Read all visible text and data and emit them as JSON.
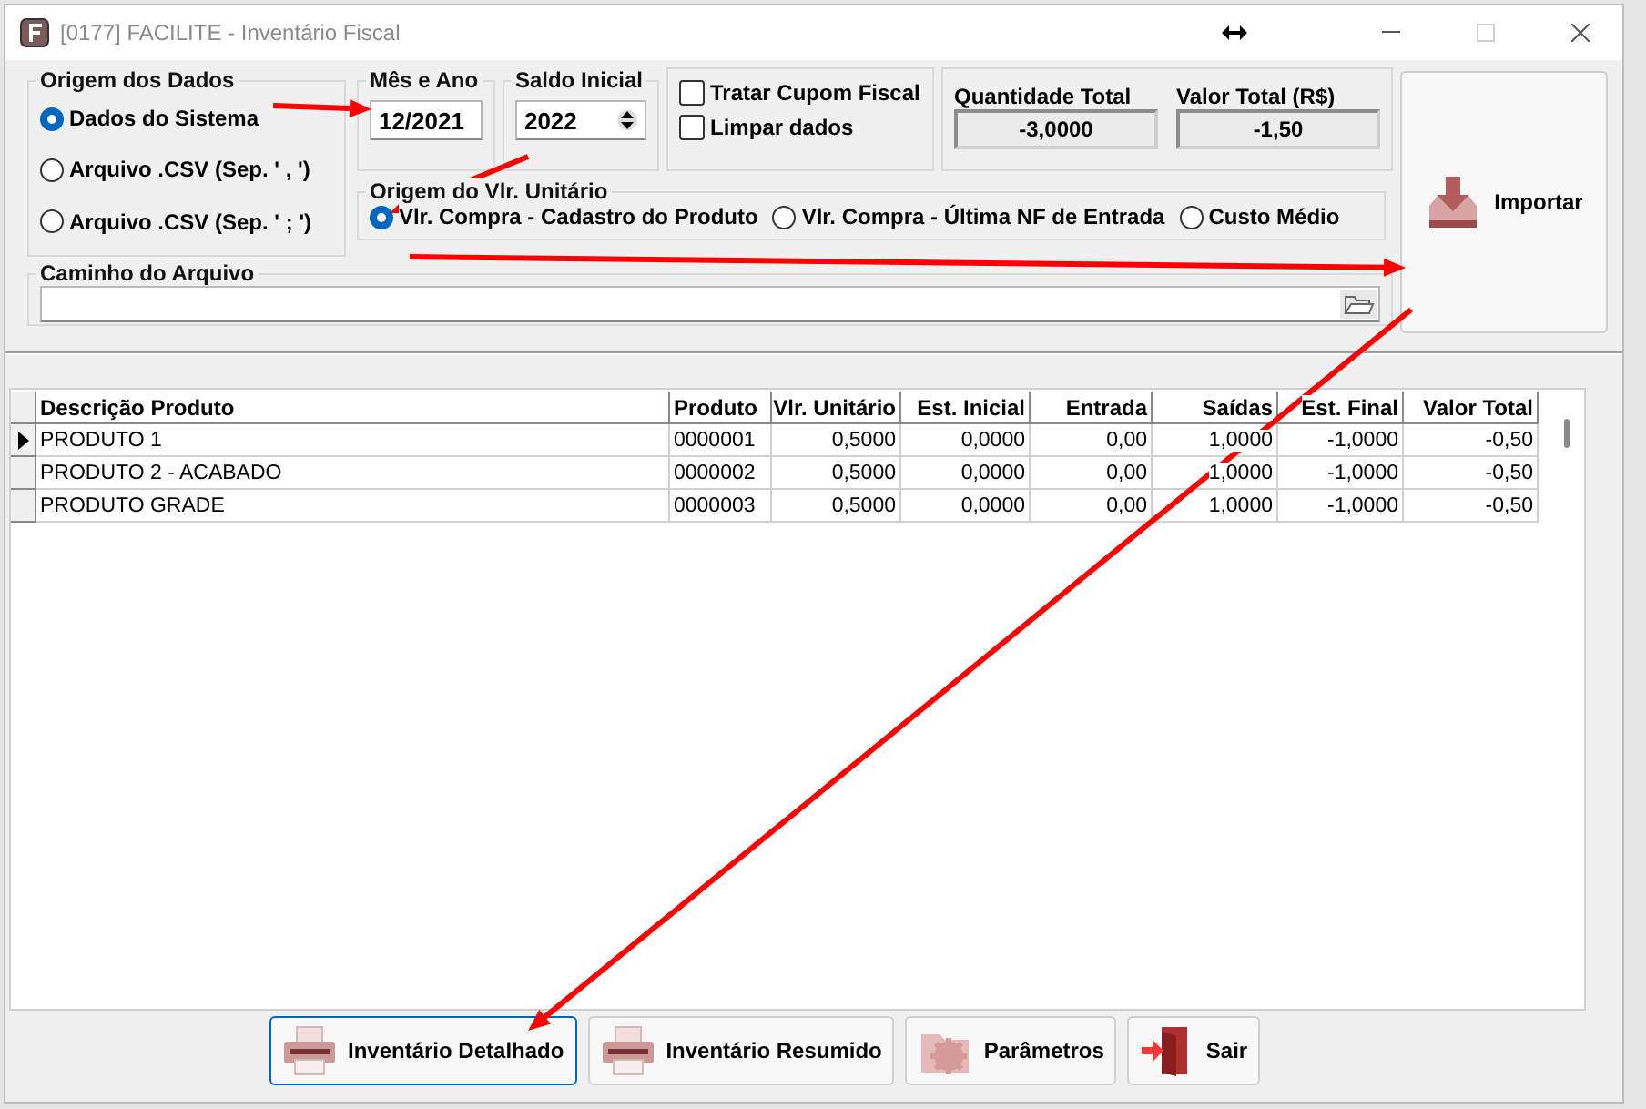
{
  "window": {
    "title": "[0177] FACILITE - Inventário Fiscal"
  },
  "data_origin": {
    "label": "Origem dos Dados",
    "options": [
      {
        "label": "Dados do Sistema",
        "selected": true
      },
      {
        "label": "Arquivo .CSV (Sep. ' , ')",
        "selected": false
      },
      {
        "label": "Arquivo .CSV (Sep. ' ; ')",
        "selected": false
      }
    ]
  },
  "month_year": {
    "label": "Mês e Ano",
    "value": "12/2021"
  },
  "initial_balance": {
    "label": "Saldo Inicial",
    "value": "2022"
  },
  "options": [
    {
      "label": "Tratar Cupom Fiscal",
      "checked": false
    },
    {
      "label": "Limpar dados",
      "checked": false
    }
  ],
  "totals": [
    {
      "label": "Quantidade Total",
      "value": "-3,0000"
    },
    {
      "label": "Valor Total (R$)",
      "value": "-1,50"
    }
  ],
  "unit_value_origin": {
    "label": "Origem do Vlr. Unitário",
    "options": [
      {
        "label": "Vlr. Compra - Cadastro do Produto",
        "selected": true
      },
      {
        "label": "Vlr. Compra - Última NF de Entrada",
        "selected": false
      },
      {
        "label": "Custo Médio",
        "selected": false
      }
    ]
  },
  "file_path": {
    "label": "Caminho do Arquivo"
  },
  "import_button": {
    "label": "Importar"
  },
  "table": {
    "columns": [
      "Descrição Produto",
      "Produto",
      "Vlr. Unitário",
      "Est. Inicial",
      "Entrada",
      "Saídas",
      "Est. Final",
      "Valor Total"
    ],
    "rows": [
      {
        "selected": true,
        "cells": [
          "PRODUTO 1",
          "0000001",
          "0,5000",
          "0,0000",
          "0,00",
          "1,0000",
          "-1,0000",
          "-0,50"
        ]
      },
      {
        "selected": false,
        "cells": [
          "PRODUTO 2 - ACABADO",
          "0000002",
          "0,5000",
          "0,0000",
          "0,00",
          "1,0000",
          "-1,0000",
          "-0,50"
        ]
      },
      {
        "selected": false,
        "cells": [
          "PRODUTO GRADE",
          "0000003",
          "0,5000",
          "0,0000",
          "0,00",
          "1,0000",
          "-1,0000",
          "-0,50"
        ]
      }
    ]
  },
  "buttons": [
    {
      "kind": "print",
      "label": "Inventário Detalhado",
      "focused": true
    },
    {
      "kind": "print",
      "label": "Inventário Resumido",
      "focused": false
    },
    {
      "kind": "settings",
      "label": "Parâmetros",
      "focused": false
    },
    {
      "kind": "exit",
      "label": "Sair",
      "focused": false
    }
  ]
}
